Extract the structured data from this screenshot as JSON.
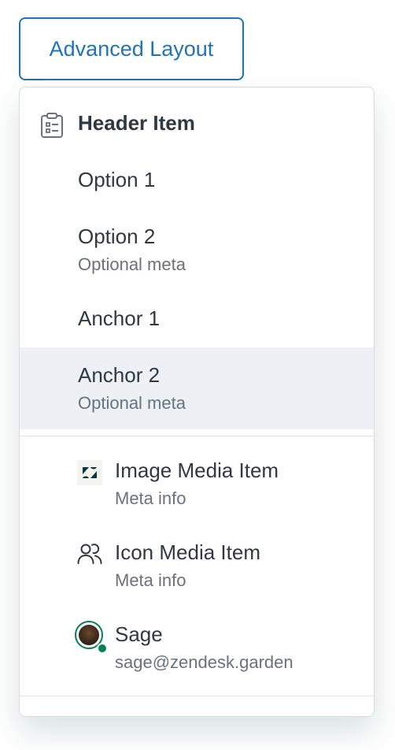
{
  "trigger": {
    "label": "Advanced Layout"
  },
  "menu": {
    "header": {
      "label": "Header Item",
      "icon": "clipboard-list-icon"
    },
    "options": [
      {
        "label": "Option 1",
        "meta": ""
      },
      {
        "label": "Option 2",
        "meta": "Optional meta"
      },
      {
        "label": "Anchor 1",
        "meta": ""
      },
      {
        "label": "Anchor 2",
        "meta": "Optional meta"
      }
    ],
    "media": [
      {
        "label": "Image Media Item",
        "meta": "Meta info",
        "icon": "zendesk-logo-icon"
      },
      {
        "label": "Icon Media Item",
        "meta": "Meta info",
        "icon": "user-group-icon"
      },
      {
        "label": "Sage",
        "meta": "sage@zendesk.garden",
        "icon": "avatar"
      }
    ]
  },
  "colors": {
    "accent": "#1f73b7",
    "hover": "#edf1f5",
    "text": "#2f3941",
    "meta": "#68737d",
    "status": "#038153"
  }
}
